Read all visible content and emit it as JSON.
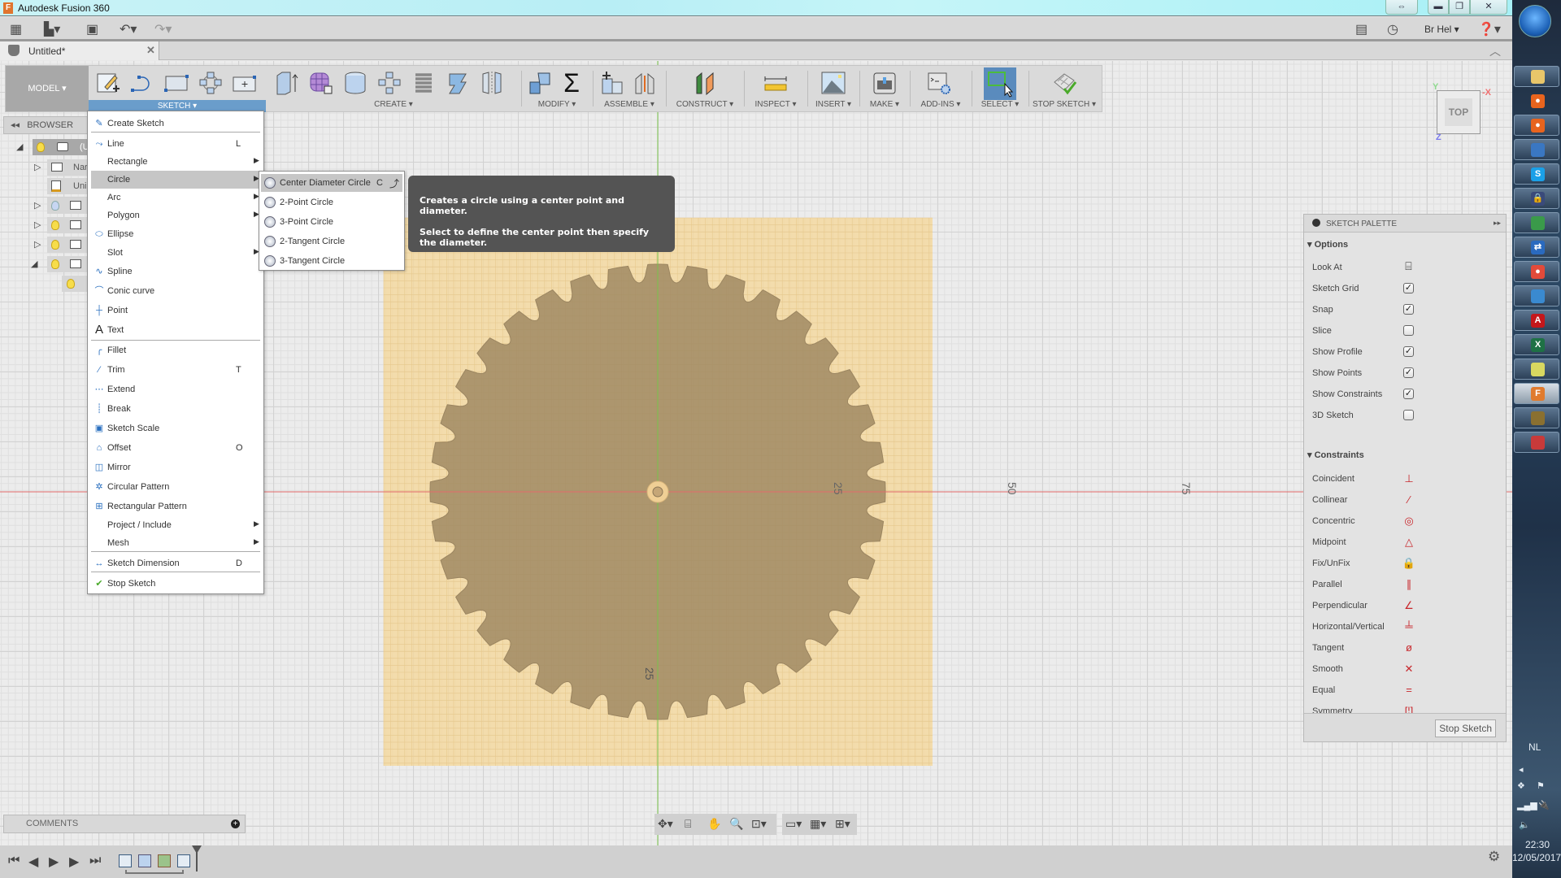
{
  "window": {
    "title": "Autodesk Fusion 360",
    "controls": [
      "restore-swap",
      "minimize",
      "maximize",
      "close"
    ]
  },
  "appbar": {
    "icons": [
      "grid-menu-icon",
      "file-icon",
      "save-icon",
      "undo-icon",
      "redo-icon"
    ],
    "user": "Br Hel",
    "right_icons": [
      "comment-icon",
      "clock-icon",
      "help-icon"
    ]
  },
  "document_tab": {
    "label": "Untitled*"
  },
  "toolbar": {
    "workspace": "MODEL",
    "groups": [
      {
        "label": "SKETCH",
        "active": true
      },
      {
        "label": "CREATE"
      },
      {
        "label": "MODIFY"
      },
      {
        "label": "ASSEMBLE"
      },
      {
        "label": "CONSTRUCT"
      },
      {
        "label": "INSPECT"
      },
      {
        "label": "INSERT"
      },
      {
        "label": "MAKE"
      },
      {
        "label": "ADD-INS"
      },
      {
        "label": "SELECT"
      },
      {
        "label": "STOP SKETCH"
      }
    ]
  },
  "browser": {
    "title": "BROWSER",
    "rows": [
      {
        "label": "(U",
        "expanded": true,
        "light": true,
        "selected": true
      },
      {
        "label": "Nar",
        "expanded": false
      },
      {
        "label": "Uni"
      },
      {
        "label": "",
        "expanded": false,
        "light": false
      },
      {
        "label": "",
        "expanded": false,
        "light": true
      },
      {
        "label": "",
        "expanded": false,
        "light": true
      },
      {
        "label": "",
        "expanded": true,
        "light": true
      },
      {
        "label": "",
        "light": true
      }
    ]
  },
  "sketch_menu": {
    "items": [
      {
        "label": "Create Sketch",
        "shortcut": "",
        "submenu": false,
        "icon": "create-sketch-icon"
      },
      {
        "label": "Line",
        "shortcut": "L",
        "submenu": false,
        "icon": "line-icon"
      },
      {
        "label": "Rectangle",
        "shortcut": "",
        "submenu": true,
        "icon": ""
      },
      {
        "label": "Circle",
        "shortcut": "",
        "submenu": true,
        "icon": "",
        "highlighted": true
      },
      {
        "label": "Arc",
        "shortcut": "",
        "submenu": true,
        "icon": ""
      },
      {
        "label": "Polygon",
        "shortcut": "",
        "submenu": true,
        "icon": ""
      },
      {
        "label": "Ellipse",
        "shortcut": "",
        "submenu": false,
        "icon": "ellipse-icon"
      },
      {
        "label": "Slot",
        "shortcut": "",
        "submenu": true,
        "icon": ""
      },
      {
        "label": "Spline",
        "shortcut": "",
        "submenu": false,
        "icon": "spline-icon"
      },
      {
        "label": "Conic curve",
        "shortcut": "",
        "submenu": false,
        "icon": "conic-curve-icon"
      },
      {
        "label": "Point",
        "shortcut": "",
        "submenu": false,
        "icon": "point-icon"
      },
      {
        "label": "Text",
        "shortcut": "",
        "submenu": false,
        "icon": "text-icon"
      },
      {
        "label": "Fillet",
        "shortcut": "",
        "submenu": false,
        "icon": "fillet-icon"
      },
      {
        "label": "Trim",
        "shortcut": "T",
        "submenu": false,
        "icon": "trim-icon"
      },
      {
        "label": "Extend",
        "shortcut": "",
        "submenu": false,
        "icon": "extend-icon"
      },
      {
        "label": "Break",
        "shortcut": "",
        "submenu": false,
        "icon": "break-icon"
      },
      {
        "label": "Sketch Scale",
        "shortcut": "",
        "submenu": false,
        "icon": "sketch-scale-icon"
      },
      {
        "label": "Offset",
        "shortcut": "O",
        "submenu": false,
        "icon": "offset-icon"
      },
      {
        "label": "Mirror",
        "shortcut": "",
        "submenu": false,
        "icon": "mirror-icon"
      },
      {
        "label": "Circular Pattern",
        "shortcut": "",
        "submenu": false,
        "icon": "circular-pattern-icon"
      },
      {
        "label": "Rectangular Pattern",
        "shortcut": "",
        "submenu": false,
        "icon": "rectangular-pattern-icon"
      },
      {
        "label": "Project / Include",
        "shortcut": "",
        "submenu": true,
        "icon": ""
      },
      {
        "label": "Mesh",
        "shortcut": "",
        "submenu": true,
        "icon": ""
      },
      {
        "label": "Sketch Dimension",
        "shortcut": "D",
        "submenu": false,
        "icon": "sketch-dimension-icon"
      },
      {
        "label": "Stop Sketch",
        "shortcut": "",
        "submenu": false,
        "icon": "stop-sketch-icon"
      }
    ]
  },
  "circle_submenu": {
    "items": [
      {
        "label": "Center Diameter Circle",
        "shortcut": "C",
        "highlighted": true
      },
      {
        "label": "2-Point Circle",
        "shortcut": ""
      },
      {
        "label": "3-Point Circle",
        "shortcut": ""
      },
      {
        "label": "2-Tangent Circle",
        "shortcut": ""
      },
      {
        "label": "3-Tangent Circle",
        "shortcut": ""
      }
    ]
  },
  "tooltip": {
    "line1": "Creates a circle using a center point and diameter.",
    "line2": "Select to define the center point then specify the diameter."
  },
  "viewcube": {
    "face": "TOP",
    "axes": {
      "x": "X",
      "y": "Y",
      "z": "Z"
    }
  },
  "canvas": {
    "axis_labels": [
      "25",
      "50",
      "75",
      "25"
    ],
    "gear_teeth": 36,
    "colors": {
      "sketch_plane": "#f3d59c",
      "profile": "#a8916a",
      "x_axis": "#e06060",
      "y_axis": "#7ac24a"
    }
  },
  "sketch_palette": {
    "title": "SKETCH PALETTE",
    "options_title": "Options",
    "options": [
      {
        "label": "Look At",
        "type": "button"
      },
      {
        "label": "Sketch Grid",
        "checked": true
      },
      {
        "label": "Snap",
        "checked": true
      },
      {
        "label": "Slice",
        "checked": false
      },
      {
        "label": "Show Profile",
        "checked": true
      },
      {
        "label": "Show Points",
        "checked": true
      },
      {
        "label": "Show Constraints",
        "checked": true
      },
      {
        "label": "3D Sketch",
        "checked": false
      }
    ],
    "constraints_title": "Constraints",
    "constraints": [
      {
        "label": "Coincident",
        "glyph": "⊥"
      },
      {
        "label": "Collinear",
        "glyph": "⁄"
      },
      {
        "label": "Concentric",
        "glyph": "◎"
      },
      {
        "label": "Midpoint",
        "glyph": "△"
      },
      {
        "label": "Fix/UnFix",
        "glyph": "🔒"
      },
      {
        "label": "Parallel",
        "glyph": "∥"
      },
      {
        "label": "Perpendicular",
        "glyph": "∠"
      },
      {
        "label": "Horizontal/Vertical",
        "glyph": "╧"
      },
      {
        "label": "Tangent",
        "glyph": "ø"
      },
      {
        "label": "Smooth",
        "glyph": "✕"
      },
      {
        "label": "Equal",
        "glyph": "="
      },
      {
        "label": "Symmetry",
        "glyph": "[¦]"
      }
    ],
    "stop_button": "Stop Sketch"
  },
  "comments": {
    "label": "COMMENTS"
  },
  "taskbar": {
    "apps": [
      "file-explorer",
      "firefox",
      "firefox",
      "thunderbird",
      "skype",
      "keepass",
      "system-monitor",
      "teamviewer",
      "chrome",
      "remote-desktop",
      "acrobat",
      "excel",
      "notepad",
      "fusion-360",
      "gimp",
      "alarm"
    ],
    "language": "NL",
    "time": "22:30",
    "date": "12/05/2017"
  }
}
